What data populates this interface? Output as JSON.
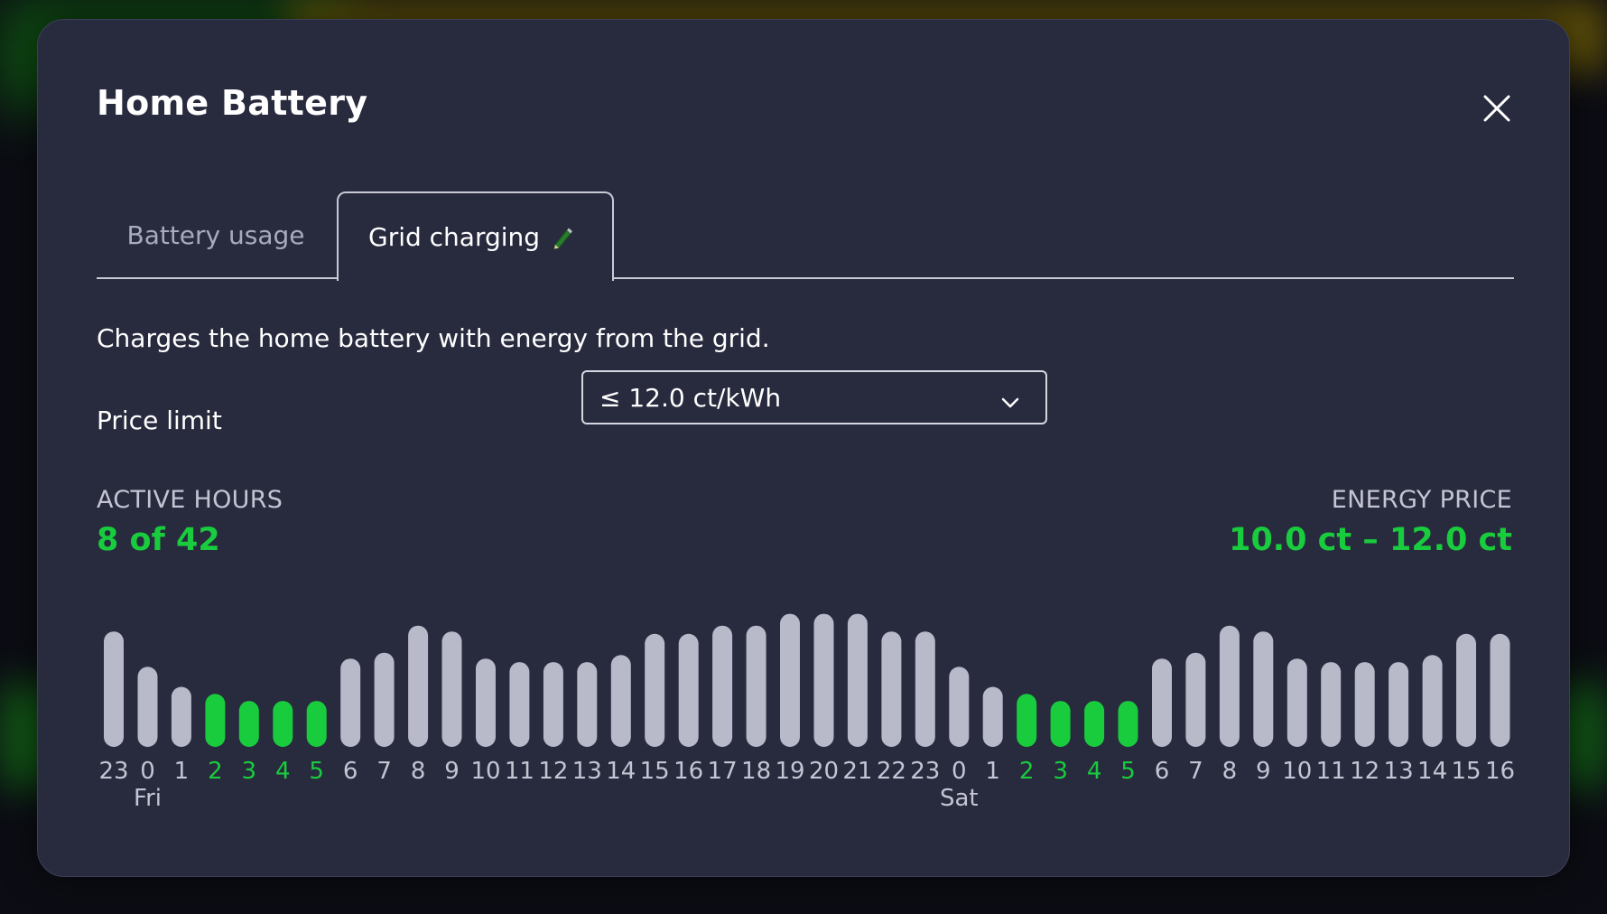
{
  "dialog": {
    "title": "Home Battery",
    "close_icon": "close-icon"
  },
  "tabs": [
    {
      "label": "Battery usage",
      "active": false
    },
    {
      "label": "Grid charging",
      "active": true,
      "icon": "pencil-icon"
    }
  ],
  "description": "Charges the home battery with energy from the grid.",
  "price_limit": {
    "label": "Price limit",
    "selected": "≤ 12.0 ct/kWh",
    "icon": "chevron-down-icon"
  },
  "summary": {
    "active_hours_label": "ACTIVE HOURS",
    "active_hours_value": "8 of 42",
    "energy_price_label": "ENERGY PRICE",
    "energy_price_value": "10.0 ct – 12.0 ct"
  },
  "colors": {
    "accent": "#19cc3d",
    "bar_inactive": "#b8b9c9",
    "background": "#282a3e"
  },
  "chart_data": {
    "type": "bar",
    "categories": [
      "23",
      "0",
      "1",
      "2",
      "3",
      "4",
      "5",
      "6",
      "7",
      "8",
      "9",
      "10",
      "11",
      "12",
      "13",
      "14",
      "15",
      "16",
      "17",
      "18",
      "19",
      "20",
      "21",
      "22",
      "23",
      "0",
      "1",
      "2",
      "3",
      "4",
      "5",
      "6",
      "7",
      "8",
      "9",
      "10",
      "11",
      "12",
      "13",
      "14",
      "15",
      "16"
    ],
    "values": [
      98,
      68,
      51,
      45,
      39,
      39,
      39,
      75,
      80,
      103,
      98,
      75,
      72,
      72,
      72,
      78,
      96,
      96,
      103,
      103,
      113,
      113,
      113,
      98,
      98,
      68,
      51,
      45,
      39,
      39,
      39,
      75,
      80,
      103,
      98,
      75,
      72,
      72,
      72,
      78,
      96,
      96
    ],
    "active": [
      false,
      false,
      false,
      true,
      true,
      true,
      true,
      false,
      false,
      false,
      false,
      false,
      false,
      false,
      false,
      false,
      false,
      false,
      false,
      false,
      false,
      false,
      false,
      false,
      false,
      false,
      false,
      true,
      true,
      true,
      true,
      false,
      false,
      false,
      false,
      false,
      false,
      false,
      false,
      false,
      false,
      false
    ],
    "day_labels": [
      {
        "index": 1,
        "label": "Fri"
      },
      {
        "index": 25,
        "label": "Sat"
      }
    ],
    "ylim": [
      0,
      115
    ]
  }
}
